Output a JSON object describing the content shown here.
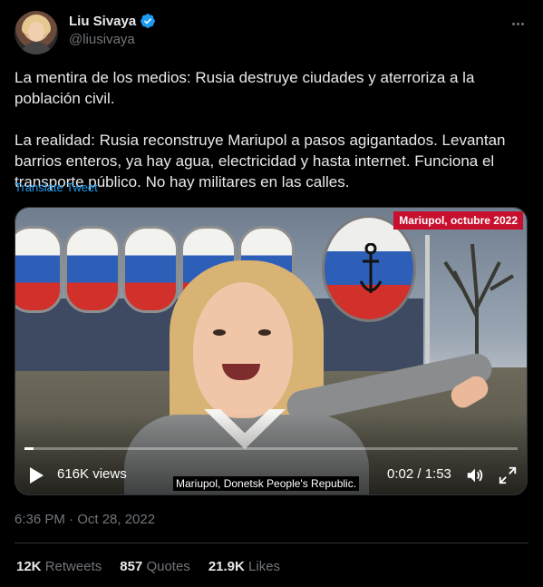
{
  "author": {
    "display_name": "Liu Sivaya",
    "handle": "@liusivaya",
    "verified_color": "#1d9bf0"
  },
  "tweet": {
    "text": "La mentira de los medios: Rusia destruye ciudades y aterroriza a la población civil.\n\nLa realidad: Rusia reconstruye Mariupol a pasos agigantados. Levantan barrios enteros, ya hay agua, electricidad y hasta internet. Funciona el transporte público. No hay militares en las calles.",
    "translate_label": "Translate Tweet",
    "timestamp": "6:36 PM · Oct 28, 2022"
  },
  "video": {
    "location_badge": "Mariupol, octubre 2022",
    "views": "616K views",
    "caption": "Mariupol, Donetsk People's Republic.",
    "time": "0:02 / 1:53",
    "progress_fraction": 0.018
  },
  "stats": {
    "retweets_count": "12K",
    "retweets_label": "Retweets",
    "quotes_count": "857",
    "quotes_label": "Quotes",
    "likes_count": "21.9K",
    "likes_label": "Likes"
  },
  "colors": {
    "background": "#000000",
    "text": "#e7e9ea",
    "muted": "#71767b",
    "link": "#1d9bf0",
    "badge": "#c8102e"
  }
}
